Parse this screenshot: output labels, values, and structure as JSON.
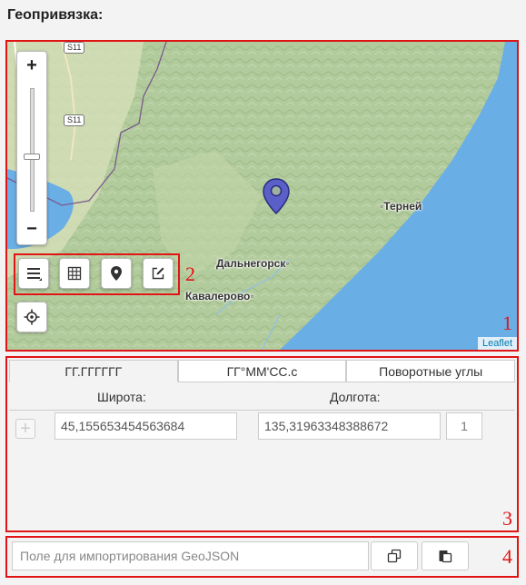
{
  "section_title": "Геопривязка:",
  "map": {
    "zoom_in": "+",
    "zoom_out": "−",
    "attribution": "Leaflet",
    "labels": {
      "terney": "Терней",
      "dalnegorsk": "Дальнегорск",
      "kavalerovo": "Кавалерово"
    },
    "road_shields": [
      "S11",
      "S11"
    ],
    "tools": [
      "menu-icon",
      "grid-icon",
      "marker-icon",
      "edit-icon"
    ],
    "locate": "locate-icon",
    "annotations": {
      "map": "1",
      "tools": "2"
    },
    "colors": {
      "water": "#6aaee6",
      "land": "#b7cfa3",
      "marker": "#5b5fc8"
    }
  },
  "coords": {
    "tabs": [
      "ГГ.ГГГГГГ",
      "ГГ°ММ'СС.с",
      "Поворотные углы"
    ],
    "active_tab": 0,
    "lat_header": "Широта:",
    "lon_header": "Долгота:",
    "add_label": "+",
    "rows": [
      {
        "lat": "45,155653454563684",
        "lon": "135,31963348388672",
        "index": "1"
      }
    ],
    "annotation": "3"
  },
  "import": {
    "placeholder": "Поле для импортирования GeoJSON",
    "annotation": "4"
  }
}
